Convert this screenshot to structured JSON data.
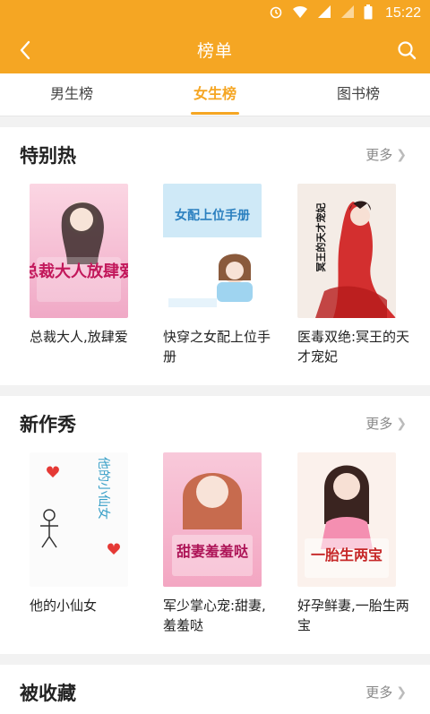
{
  "status_bar": {
    "time": "15:22"
  },
  "app_bar": {
    "title": "榜单"
  },
  "tabs": [
    {
      "label": "男生榜",
      "active": false
    },
    {
      "label": "女生榜",
      "active": true
    },
    {
      "label": "图书榜",
      "active": false
    }
  ],
  "sections": [
    {
      "title": "特别热",
      "more_label": "更多",
      "books": [
        {
          "title": "总裁大人,放肆爱",
          "cover_text": "总裁大人放肆爱"
        },
        {
          "title": "快穿之女配上位手册",
          "cover_text": "女配上位手册"
        },
        {
          "title": "医毒双绝:冥王的天才宠妃",
          "cover_text": "冥王的天才宠妃"
        }
      ]
    },
    {
      "title": "新作秀",
      "more_label": "更多",
      "books": [
        {
          "title": "他的小仙女",
          "cover_text": "他的小仙女"
        },
        {
          "title": "军少掌心宠:甜妻,羞羞哒",
          "cover_text": "甜妻羞羞哒"
        },
        {
          "title": "好孕鲜妻,一胎生两宝",
          "cover_text": "一胎生两宝"
        }
      ]
    },
    {
      "title": "被收藏",
      "more_label": "更多"
    }
  ],
  "colors": {
    "accent": "#f5a623"
  }
}
